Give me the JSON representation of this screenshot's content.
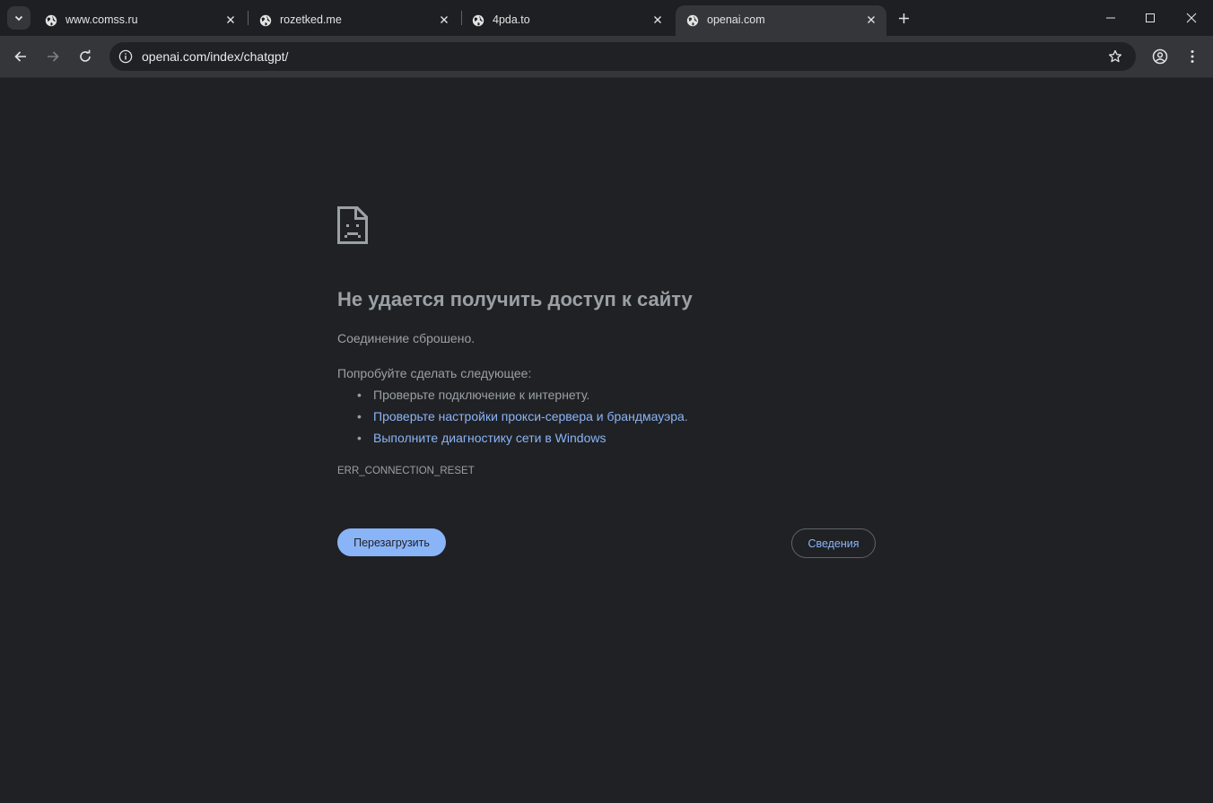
{
  "browser": {
    "tabs": [
      {
        "title": "www.comss.ru",
        "active": false
      },
      {
        "title": "rozetked.me",
        "active": false
      },
      {
        "title": "4pda.to",
        "active": false
      },
      {
        "title": "openai.com",
        "active": true
      }
    ],
    "address": "openai.com/index/chatgpt/"
  },
  "error_page": {
    "heading": "Не удается получить доступ к сайту",
    "subtitle": "Соединение сброшено.",
    "try_label": "Попробуйте сделать следующее:",
    "suggestion_check": "Проверьте подключение к интернету.",
    "suggestion_proxy_link": "Проверьте настройки прокси-сервера и брандмауэра",
    "suggestion_proxy_dot": ".",
    "suggestion_diag_link": "Выполните диагностику сети в Windows",
    "error_code": "ERR_CONNECTION_RESET",
    "reload_button": "Перезагрузить",
    "details_button": "Сведения"
  },
  "icons": {
    "tab_search": "chevron-down-icon",
    "favicon": "globe-icon",
    "tab_close": "close-icon",
    "new_tab": "plus-icon",
    "minimize": "minimize-icon",
    "maximize": "maximize-icon",
    "window_close": "close-icon",
    "back": "arrow-left-icon",
    "forward": "arrow-right-icon",
    "reload": "reload-icon",
    "site_info": "info-icon",
    "bookmark": "star-icon",
    "profile": "profile-icon",
    "menu": "kebab-menu-icon",
    "sad_page": "sad-page-icon"
  },
  "colors": {
    "page_background": "#202124",
    "text": "#9aa0a6",
    "link": "#8ab4f8",
    "primary_button": "#8ab4f8"
  }
}
